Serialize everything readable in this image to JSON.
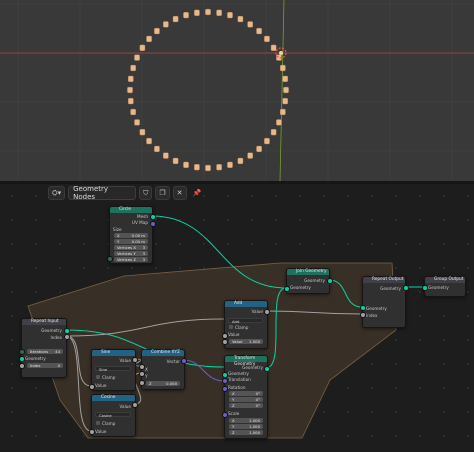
{
  "colors": {
    "viewport_bg": "#393939",
    "x_axis": "#b3454d",
    "y_axis": "#76a02b",
    "point": "#e8b88a",
    "frame_fill": "#3d3228",
    "frame_border": "#7c6142",
    "header_geometry": "#1d725e",
    "header_converter": "#246283",
    "header_input": "#413f48",
    "socket_geometry": "#00d6a3",
    "socket_float": "#a1a1a1",
    "socket_vector": "#6363c7",
    "socket_int": "#35694f"
  },
  "node_editor": {
    "title": "Geometry Nodes",
    "icons": [
      "node-tree-icon",
      "shield-icon",
      "duplicate-icon",
      "close-icon",
      "pin-icon"
    ]
  },
  "nodes": {
    "circle": {
      "title": "Circle",
      "out_mesh": "Mesh",
      "out_uvmap": "UV Map",
      "in_size": "Size",
      "radius_x": "0.00 m",
      "radius_y": "0.00 m",
      "vertices": [
        {
          "label": "Vertices X",
          "value": "3"
        },
        {
          "label": "Vertices Y",
          "value": "3"
        },
        {
          "label": "Vertices Z",
          "value": "3"
        }
      ]
    },
    "join": {
      "title": "Join Geometry",
      "out": "Geometry",
      "in": "Geometry"
    },
    "repeat_output": {
      "title": "Repeat Output",
      "out": "Geometry",
      "in_geometry": "Geometry",
      "in_index": "Index"
    },
    "group_output": {
      "title": "Group Output",
      "in": "Geometry"
    },
    "repeat_input": {
      "title": "Repeat Input",
      "out_geometry": "Geometry",
      "out_index": "Index",
      "in_iterations": "Iterations",
      "iterations": "44",
      "in_geometry": "Geometry",
      "in_index": "Index",
      "index_value": "0"
    },
    "add": {
      "title": "Add",
      "out": "Value",
      "op": "Add",
      "clamp": "Clamp",
      "in_value": "Value",
      "value": "Value",
      "value_num": "1.000"
    },
    "transform": {
      "title": "Transform Geometry",
      "out": "Geometry",
      "in": "Geometry",
      "translation": "Translation",
      "rotation": "Rotation",
      "rot": [
        "0°",
        "0°",
        "0°"
      ],
      "scale": "Scale",
      "sc": [
        "1.000",
        "1.000",
        "1.000"
      ],
      "axes": [
        "X",
        "Y",
        "Z"
      ]
    },
    "sine": {
      "title": "Sine",
      "out": "Value",
      "op": "Sine",
      "clamp": "Clamp",
      "in": "Value"
    },
    "cosine": {
      "title": "Cosine",
      "out": "Value",
      "op": "Cosine",
      "clamp": "Clamp",
      "in": "Value"
    },
    "combine": {
      "title": "Combine XYZ",
      "out": "Vector",
      "x": "X",
      "y": "Y",
      "z": "Z",
      "z_value": "0.000"
    }
  }
}
